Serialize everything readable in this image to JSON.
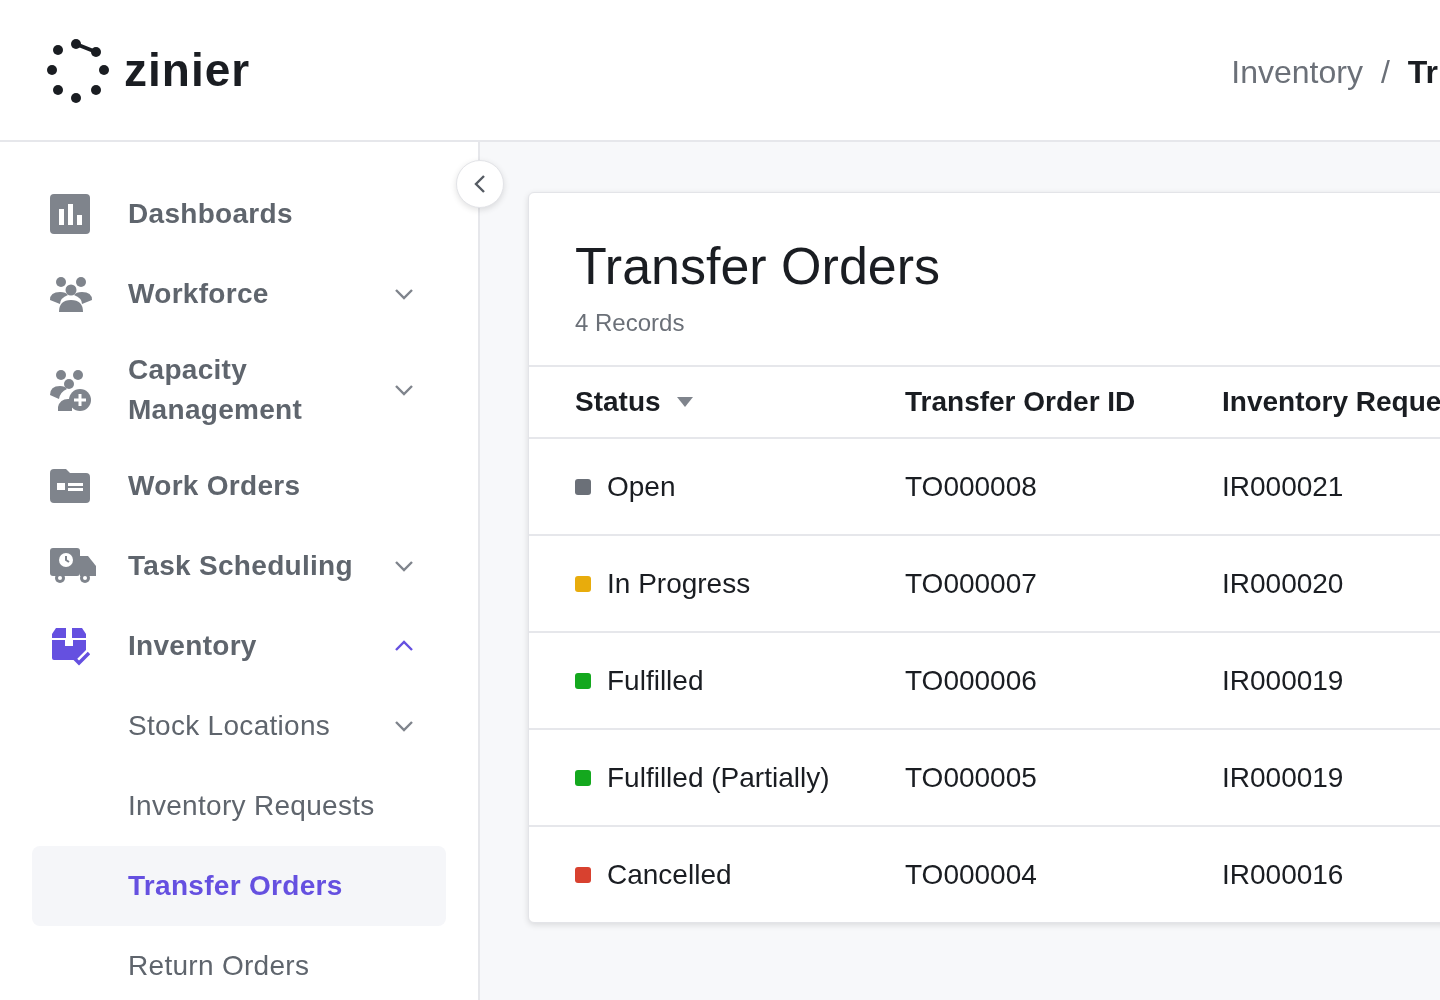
{
  "header": {
    "logo": "zinier",
    "breadcrumb": [
      "Inventory",
      "Tr"
    ],
    "breadcrumb_separator": "/"
  },
  "sidebar": {
    "items": [
      {
        "label": "Dashboards",
        "selected": false
      },
      {
        "label": "Workforce",
        "selected": false,
        "expanded": false
      },
      {
        "label": "Capacity Management",
        "selected": false,
        "expanded": false
      },
      {
        "label": "Work Orders",
        "selected": false
      },
      {
        "label": "Task Scheduling",
        "selected": false,
        "expanded": false
      },
      {
        "label": "Inventory",
        "selected": false,
        "expanded": true,
        "children": [
          {
            "label": "Stock Locations",
            "selected": false,
            "expanded": false
          },
          {
            "label": "Inventory Requests",
            "selected": false
          },
          {
            "label": "Transfer Orders",
            "selected": true
          },
          {
            "label": "Return Orders",
            "selected": false
          }
        ]
      }
    ]
  },
  "content": {
    "title": "Transfer Orders",
    "subtitle": "4 Records",
    "table": {
      "columns": [
        "Status",
        "Transfer Order ID",
        "Inventory Reque"
      ],
      "rows": [
        {
          "status": "Open",
          "color": "#6b7078",
          "id": "TO000008",
          "request": "IR000021"
        },
        {
          "status": "In Progress",
          "color": "#e8ac0c",
          "id": "TO000007",
          "request": "IR000020"
        },
        {
          "status": "Fulfilled",
          "color": "#14a81e",
          "id": "TO000006",
          "request": "IR000019"
        },
        {
          "status": "Fulfilled (Partially)",
          "color": "#14a81e",
          "id": "TO000005",
          "request": "IR000019"
        },
        {
          "status": "Cancelled",
          "color": "#d8412f",
          "id": "TO000004",
          "request": "IR000016"
        }
      ]
    }
  }
}
